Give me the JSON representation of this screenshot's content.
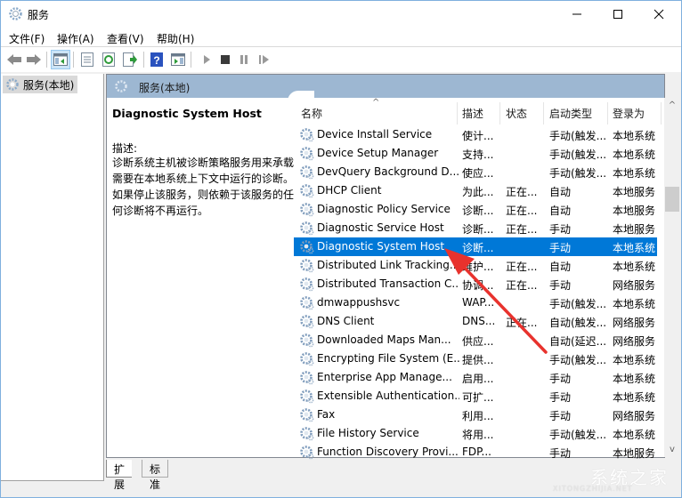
{
  "window": {
    "title": "服务",
    "controls": {
      "minimize": "—",
      "maximize": "☐",
      "close": "✕"
    }
  },
  "menu": [
    {
      "label": "文件(F)"
    },
    {
      "label": "操作(A)"
    },
    {
      "label": "查看(V)"
    },
    {
      "label": "帮助(H)"
    }
  ],
  "toolbar": {
    "buttons": [
      {
        "name": "back-icon"
      },
      {
        "name": "forward-icon"
      },
      {
        "name": "show-hide-console-tree-icon"
      },
      {
        "name": "properties-icon"
      },
      {
        "name": "refresh-icon"
      },
      {
        "name": "export-list-icon"
      },
      {
        "name": "help-icon"
      },
      {
        "name": "show-hide-action-pane-icon"
      },
      {
        "name": "start-service-icon"
      },
      {
        "name": "stop-service-icon"
      },
      {
        "name": "pause-service-icon"
      },
      {
        "name": "restart-service-icon"
      }
    ]
  },
  "tree": {
    "items": [
      {
        "label": "服务(本地)"
      }
    ]
  },
  "pane": {
    "header_title": "服务(本地)",
    "selected_title": "Diagnostic System Host",
    "desc_label": "描述:",
    "desc_text": "诊断系统主机被诊断策略服务用来承载需要在本地系统上下文中运行的诊断。如果停止该服务，则依赖于该服务的任何诊断将不再运行。"
  },
  "list": {
    "columns": [
      "名称",
      "描述",
      "状态",
      "启动类型",
      "登录为"
    ],
    "sort_indicator": "^",
    "rows": [
      {
        "name": "Device Install Service",
        "desc": "使计...",
        "status": "",
        "startup": "手动(触发...",
        "logon": "本地系统"
      },
      {
        "name": "Device Setup Manager",
        "desc": "支持...",
        "status": "",
        "startup": "手动(触发...",
        "logon": "本地系统"
      },
      {
        "name": "DevQuery Background D...",
        "desc": "使应...",
        "status": "",
        "startup": "手动(触发...",
        "logon": "本地系统"
      },
      {
        "name": "DHCP Client",
        "desc": "为此...",
        "status": "正在...",
        "startup": "自动",
        "logon": "本地服务"
      },
      {
        "name": "Diagnostic Policy Service",
        "desc": "诊断...",
        "status": "正在...",
        "startup": "自动",
        "logon": "本地服务"
      },
      {
        "name": "Diagnostic Service Host",
        "desc": "诊断...",
        "status": "正在...",
        "startup": "手动",
        "logon": "本地服务"
      },
      {
        "name": "Diagnostic System Host",
        "desc": "诊断...",
        "status": "",
        "startup": "手动",
        "logon": "本地系统",
        "selected": true
      },
      {
        "name": "Distributed Link Tracking...",
        "desc": "维护...",
        "status": "正在...",
        "startup": "自动",
        "logon": "本地系统"
      },
      {
        "name": "Distributed Transaction C...",
        "desc": "协调...",
        "status": "正在...",
        "startup": "手动",
        "logon": "网络服务"
      },
      {
        "name": "dmwappushsvc",
        "desc": "WAP...",
        "status": "",
        "startup": "手动(触发...",
        "logon": "本地系统"
      },
      {
        "name": "DNS Client",
        "desc": "DNS...",
        "status": "正在...",
        "startup": "自动(触发...",
        "logon": "网络服务"
      },
      {
        "name": "Downloaded Maps Man...",
        "desc": "供应...",
        "status": "",
        "startup": "自动(延迟...",
        "logon": "网络服务"
      },
      {
        "name": "Encrypting File System (E...",
        "desc": "提供...",
        "status": "",
        "startup": "手动(触发...",
        "logon": "本地系统"
      },
      {
        "name": "Enterprise App Manage...",
        "desc": "启用...",
        "status": "",
        "startup": "手动",
        "logon": "本地系统"
      },
      {
        "name": "Extensible Authentication...",
        "desc": "可扩...",
        "status": "",
        "startup": "手动",
        "logon": "本地系统"
      },
      {
        "name": "Fax",
        "desc": "利用...",
        "status": "",
        "startup": "手动",
        "logon": "网络服务"
      },
      {
        "name": "File History Service",
        "desc": "将用...",
        "status": "",
        "startup": "手动(触发...",
        "logon": "本地系统"
      },
      {
        "name": "Function Discovery Provi...",
        "desc": "FDP...",
        "status": "",
        "startup": "手动",
        "logon": "本地服务"
      }
    ]
  },
  "scrollbar": {
    "up": "^",
    "down": "v"
  },
  "tabs": [
    {
      "label": "扩展"
    },
    {
      "label": "标准"
    }
  ],
  "watermark": {
    "text": "系统之家",
    "sub": "XITONGZHIJIA.NET"
  },
  "colors": {
    "selection": "#0078d7",
    "pane_header": "#9db7d2",
    "annotation_arrow": "#e8322d"
  }
}
